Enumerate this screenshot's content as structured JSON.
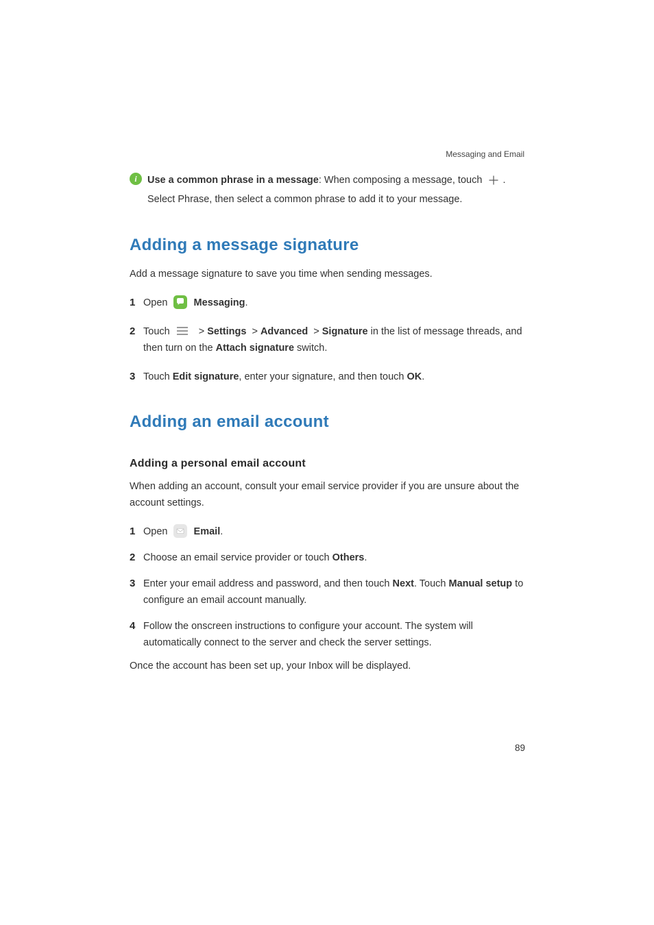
{
  "header": {
    "section_label": "Messaging and Email"
  },
  "tip": {
    "title": "Use a common phrase in a message",
    "line1_after": ": When composing a message, touch",
    "line1_after2": ".",
    "line2_a": "Select ",
    "line2_strong": "Phrase",
    "line2_b": ", then select a common phrase to add it to your message."
  },
  "h2a": "Adding a message signature",
  "para1": "Add a message signature to save you time when sending messages.",
  "sig_steps": {
    "s1": {
      "t1": "Open",
      "app": "Messaging",
      "t2": "."
    },
    "s2": {
      "t1": "Touch",
      "path": {
        "settings": "Settings",
        "advanced": "Advanced",
        "signature": "Signature"
      },
      "t2": " in the list of message threads, and then turn on the ",
      "strong": "Attach signature",
      "t3": " switch."
    },
    "s3": {
      "t1": "Touch ",
      "strong1": "Edit signature",
      "t2": ", enter your signature, and then touch ",
      "strong2": "OK",
      "t3": "."
    }
  },
  "h2b": "Adding an email account",
  "h3a": "Adding a personal email account",
  "para2": "When adding an account, consult your email service provider if you are unsure about the account settings.",
  "email_steps": {
    "s1": {
      "t1": "Open",
      "app": "Email",
      "t2": "."
    },
    "s2": {
      "t1": "Choose an email service provider or touch ",
      "strong": "Others",
      "t2": "."
    },
    "s3": {
      "t1": "Enter your email address and password, and then touch ",
      "strong1": "Next",
      "t2": ". Touch ",
      "strong2": "Manual setup",
      "t3": " to configure an email account manually."
    },
    "s4": {
      "t1": "Follow the onscreen instructions to configure your account. The system will automatically connect to the server and check the server settings."
    }
  },
  "closing": {
    "t1": "Once the account has been set up, your ",
    "strong": "Inbox",
    "t2": " will be displayed."
  },
  "page_number": "89",
  "gt": ">"
}
